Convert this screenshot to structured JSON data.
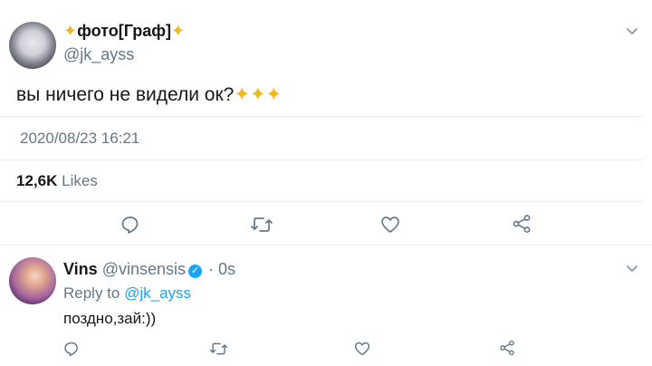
{
  "tweet": {
    "display_name": "фото[Граф]",
    "sparkle_glyph": "✦",
    "handle": "@jk_ayss",
    "text": "вы ничего не видели ок?",
    "sparkles": "✦✦✦",
    "date": "2020/08/23 16:21",
    "likes_count": "12,6K",
    "likes_label": "Likes"
  },
  "reply": {
    "display_name": "Vins",
    "handle": "@vinsensis",
    "time": "· 0s",
    "reply_to_label": "Reply to",
    "reply_to_handle": "@jk_ayss",
    "text": "поздно,зай:))"
  },
  "colors": {
    "accent": "#1da1f2",
    "secondary_text": "#657786",
    "sparkle": "#f1b616",
    "divider": "#e6ecf0"
  }
}
